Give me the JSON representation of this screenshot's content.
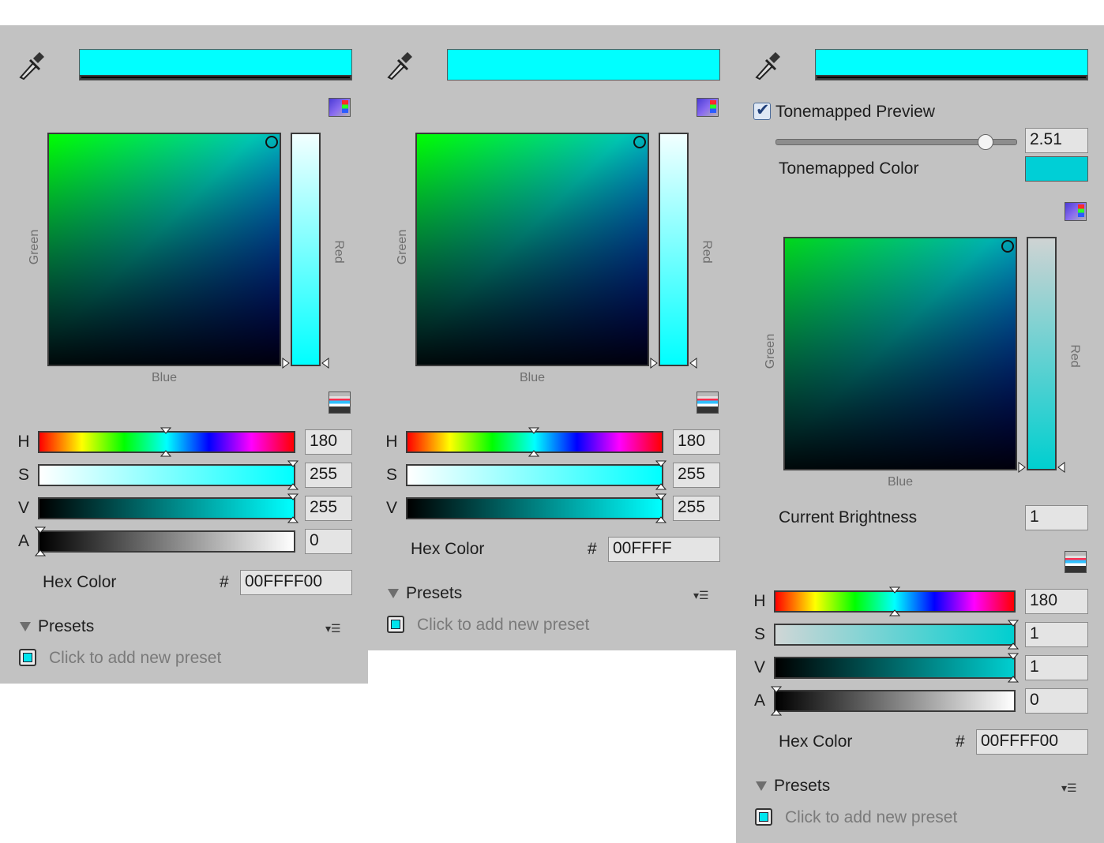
{
  "colors": {
    "panel_bg": "#c2c2c2",
    "selected_color": "#00ffff",
    "tonemapped_color": "#00cfd6"
  },
  "panels": [
    {
      "sv_axis": {
        "left": "Green",
        "bottom": "Blue",
        "right": "Red"
      },
      "sliders": [
        {
          "label": "H",
          "value": "180"
        },
        {
          "label": "S",
          "value": "255"
        },
        {
          "label": "V",
          "value": "255"
        },
        {
          "label": "A",
          "value": "0"
        }
      ],
      "hex_label": "Hex Color",
      "hash": "#",
      "hex_value": "00FFFF00",
      "presets_label": "Presets",
      "preset_hint": "Click to add new preset"
    },
    {
      "sv_axis": {
        "left": "Green",
        "bottom": "Blue",
        "right": "Red"
      },
      "sliders": [
        {
          "label": "H",
          "value": "180"
        },
        {
          "label": "S",
          "value": "255"
        },
        {
          "label": "V",
          "value": "255"
        }
      ],
      "hex_label": "Hex Color",
      "hash": "#",
      "hex_value": "00FFFF",
      "presets_label": "Presets",
      "preset_hint": "Click to add new preset"
    },
    {
      "tonemap_label": "Tonemapped Preview",
      "tonemap_checked": true,
      "exposure_value": "2.51",
      "tonemapped_color_label": "Tonemapped Color",
      "sv_axis": {
        "left": "Green",
        "bottom": "Blue",
        "right": "Red"
      },
      "brightness_label": "Current Brightness",
      "brightness_value": "1",
      "sliders": [
        {
          "label": "H",
          "value": "180"
        },
        {
          "label": "S",
          "value": "1"
        },
        {
          "label": "V",
          "value": "1"
        },
        {
          "label": "A",
          "value": "0"
        }
      ],
      "hex_label": "Hex Color",
      "hash": "#",
      "hex_value": "00FFFF00",
      "presets_label": "Presets",
      "preset_hint": "Click to add new preset"
    }
  ],
  "icons": {
    "eyedropper": "eyedropper-icon",
    "color_mode": "color-mode-icon",
    "slider_mode": "slider-mode-icon",
    "preset_add": "preset-swatch-icon",
    "presets_menu": "presets-menu-icon",
    "foldout": "foldout-triangle-icon"
  }
}
